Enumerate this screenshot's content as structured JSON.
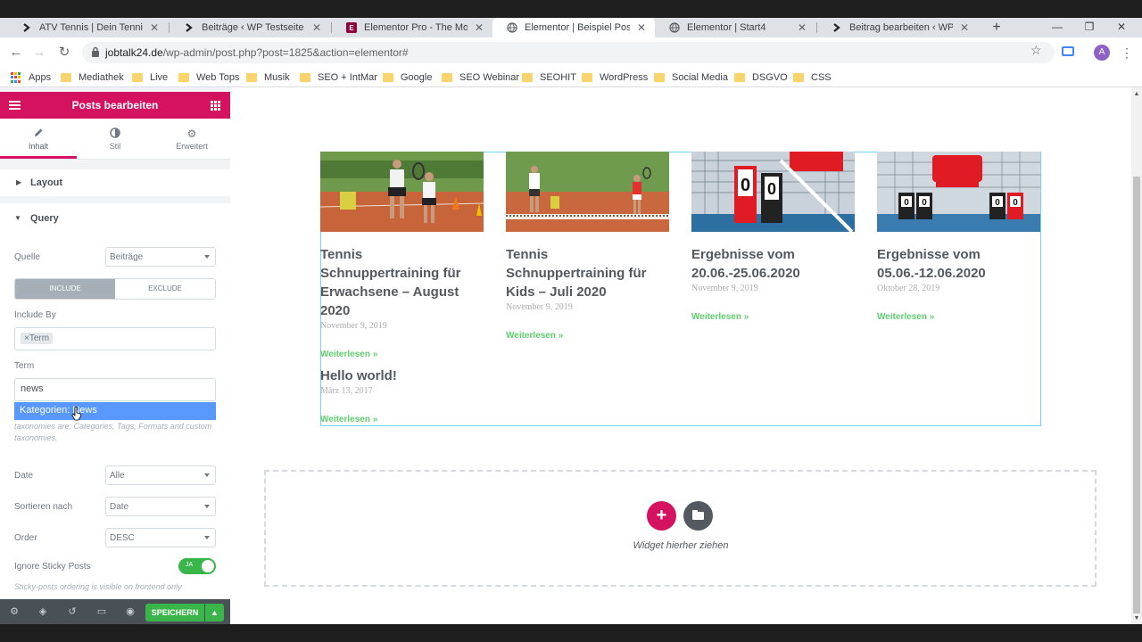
{
  "browser": {
    "tabs": [
      {
        "label": "ATV Tennis | Dein Tennisverein",
        "icon": "chevron-favicon-icon",
        "active": false
      },
      {
        "label": "Beiträge ‹ WP Testseite — W",
        "icon": "chevron-favicon-icon",
        "active": false
      },
      {
        "label": "Elementor Pro - The Most Ad",
        "icon": "elementor-favicon-icon",
        "active": false
      },
      {
        "label": "Elementor | Beispiel Post Wid",
        "icon": "globe-icon",
        "active": true
      },
      {
        "label": "Elementor | Start4",
        "icon": "globe-icon",
        "active": false
      },
      {
        "label": "Beitrag bearbeiten ‹ WP Test",
        "icon": "chevron-favicon-icon",
        "active": false
      }
    ],
    "url_host": "jobtalk24.de",
    "url_path": "/wp-admin/post.php?post=1825&action=elementor#",
    "avatar_letter": "A",
    "bookmarks": [
      "Apps",
      "Mediathek",
      "Live",
      "Web Tops",
      "Musik",
      "SEO + IntMar",
      "Google",
      "SEO Webinar",
      "SEOHIT",
      "WordPress",
      "Social Media",
      "DSGVO",
      "CSS"
    ]
  },
  "panel": {
    "title": "Posts bearbeiten",
    "tabs": [
      "Inhalt",
      "Stil",
      "Erweitert"
    ],
    "sections": {
      "layout": "Layout",
      "query": "Query"
    },
    "quelle_label": "Quelle",
    "quelle_value": "Beiträge",
    "include_label": "INCLUDE",
    "exclude_label": "EXCLUDE",
    "include_by_label": "Include By",
    "include_by_tag": "Term",
    "term_label": "Term",
    "term_input_value": "news",
    "term_option": "Kategorien: News",
    "term_help": "taxonomies are: Categories, Tags, Formats and custom taxonomies.",
    "date_label": "Date",
    "date_value": "Alle",
    "sort_label": "Sortieren nach",
    "sort_value": "Date",
    "order_label": "Order",
    "order_value": "DESC",
    "sticky_label": "Ignore Sticky Posts",
    "sticky_toggle": "JA",
    "sticky_help": "Sticky-posts ordering is visible on frontend only",
    "save_label": "SPEICHERN"
  },
  "posts": [
    {
      "title": "Tennis Schnuppertraining für Erwachsene – August 2020",
      "date": "November 9, 2019",
      "read_more": "Weiterlesen »"
    },
    {
      "title": "Tennis Schnuppertraining für Kids – Juli 2020",
      "date": "November 9, 2019",
      "read_more": "Weiterlesen »"
    },
    {
      "title": "Ergebnisse vom 20.06.-25.06.2020",
      "date": "November 9, 2019",
      "read_more": "Weiterlesen »"
    },
    {
      "title": "Ergebnisse vom 05.06.-12.06.2020",
      "date": "Oktober 28, 2019",
      "read_more": "Weiterlesen »"
    },
    {
      "title": "Hello world!",
      "date": "März 13, 2017",
      "read_more": "Weiterlesen »"
    }
  ],
  "dropzone": {
    "text": "Widget hierher ziehen"
  },
  "colors": {
    "elementor_pink": "#d5125f",
    "save_green": "#39b54a",
    "readmore_green": "#61ce70",
    "selection_blue": "#5897fb"
  }
}
